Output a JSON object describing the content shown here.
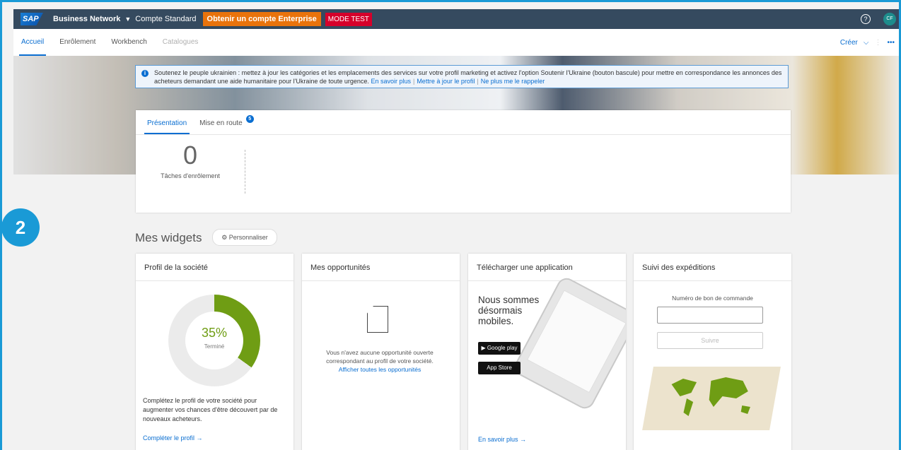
{
  "topbar": {
    "logo": "SAP",
    "network": "Business Network",
    "account_type": "Compte Standard",
    "enterprise_btn": "Obtenir un compte Enterprise",
    "mode": "MODE TEST",
    "avatar": "CF"
  },
  "nav": {
    "tabs": [
      {
        "label": "Accueil",
        "active": true
      },
      {
        "label": "Enrôlement"
      },
      {
        "label": "Workbench"
      },
      {
        "label": "Catalogues",
        "disabled": true
      }
    ],
    "create": "Créer"
  },
  "banner": {
    "text": "Soutenez le peuple ukrainien : mettez à jour les catégories et les emplacements des services sur votre profil marketing et activez l'option Soutenir l'Ukraine (bouton bascule) pour mettre en correspondance les annonces des acheteurs demandant une aide humanitaire pour l'Ukraine de toute urgence.",
    "link1": "En savoir plus",
    "link2": "Mettre à jour le profil",
    "link3": "Ne plus me le rappeler"
  },
  "overview": {
    "tabs": [
      {
        "label": "Présentation"
      },
      {
        "label": "Mise en route",
        "badge": "5"
      }
    ],
    "kpi_value": "0",
    "kpi_label": "Tâches d'enrôlement"
  },
  "widgets": {
    "title": "Mes widgets",
    "customize": "Personnaliser",
    "profile": {
      "title": "Profil de la société",
      "percent": "35%",
      "percent_value": 0.35,
      "status": "Terminé",
      "text": "Complétez le profil de votre société pour augmenter vos chances d'être découvert par de nouveaux acheteurs.",
      "link": "Compléter le profil →"
    },
    "opportunities": {
      "title": "Mes opportunités",
      "text": "Vous n'avez aucune opportunité ouverte correspondant au profil de votre société.",
      "link": "Afficher toutes les opportunités"
    },
    "app": {
      "title": "Télécharger une application",
      "tagline": "Nous sommes désormais mobiles.",
      "google": "Google play",
      "apple": "App Store",
      "link": "En savoir plus →"
    },
    "shipments": {
      "title": "Suivi des expéditions",
      "label": "Numéro de bon de commande",
      "button": "Suivre"
    }
  },
  "step_marker": "2",
  "colors": {
    "accent": "#0a6ed1",
    "shell": "#354a5f",
    "orange": "#e9730c",
    "red": "#d5002b",
    "green": "#6f9d14"
  }
}
